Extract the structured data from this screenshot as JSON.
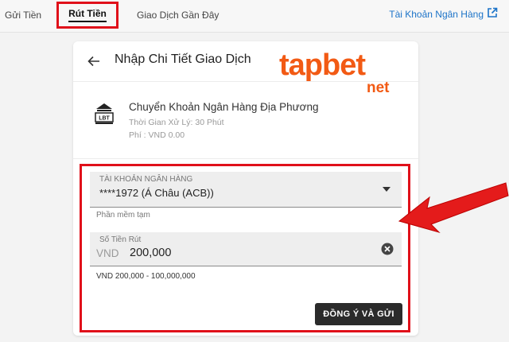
{
  "tabs": {
    "deposit": "Gửi Tiền",
    "withdraw": "Rút Tiền",
    "history": "Giao Dịch Gần Đây"
  },
  "bank_account_link": "Tài Khoản Ngân Hàng",
  "card": {
    "title": "Nhập Chi Tiết Giao Dịch",
    "method": {
      "logo_text": "LBT",
      "name": "Chuyển Khoản Ngân Hàng Địa Phương",
      "processing_time": "Thời Gian Xử Lý: 30 Phút",
      "fee": "Phí : VND 0.00"
    }
  },
  "brand": {
    "main": "tapbet",
    "sub": "net"
  },
  "form": {
    "bank_field": {
      "label": "TÀI KHOẢN NGÂN HÀNG",
      "value": "****1972 (Á Châu (ACB))"
    },
    "account_hint": "Phần mềm tạm",
    "amount_field": {
      "label": "Số Tiền Rút",
      "currency": "VND",
      "value": "200,000"
    },
    "range_hint": "VND 200,000 - 100,000,000",
    "submit_label": "ĐỒNG Ý VÀ GỬI"
  },
  "colors": {
    "highlight": "#e0101a",
    "brand": "#f25a14",
    "link": "#1d74c8",
    "button": "#2b2b2b"
  },
  "icons": [
    "external-link-icon",
    "back-arrow-icon",
    "bank-logo-icon",
    "chevron-down-icon",
    "clear-icon",
    "red-pointer-arrow"
  ]
}
